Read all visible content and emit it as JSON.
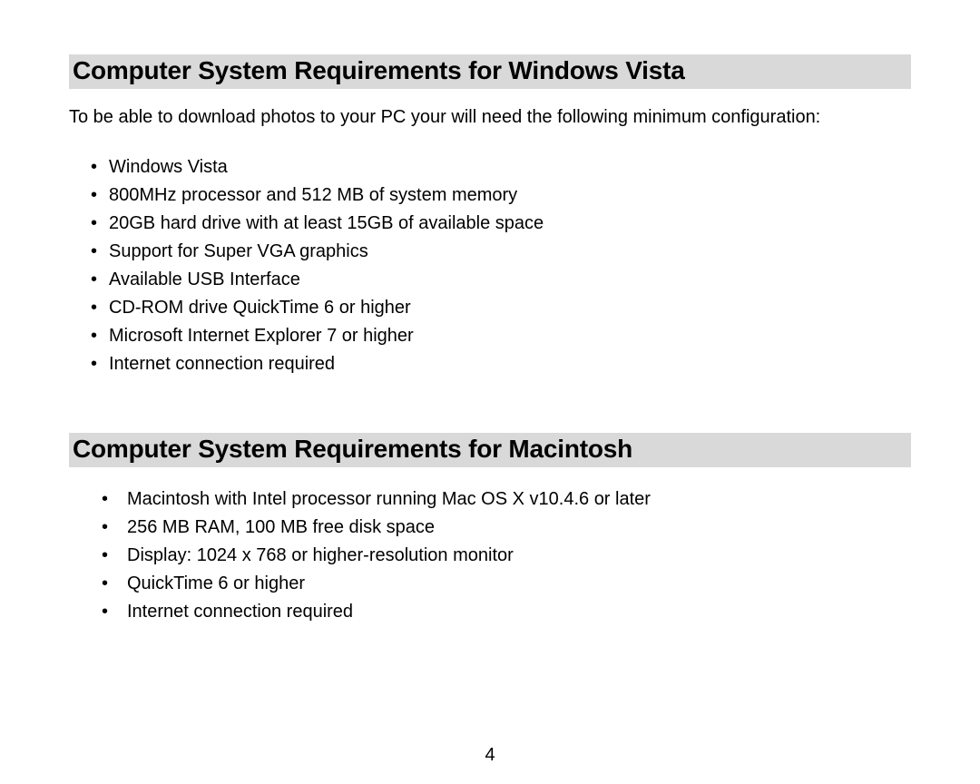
{
  "sections": {
    "windows": {
      "heading": "Computer System Requirements for Windows Vista",
      "intro": "To be able to download photos to your PC your will need the following minimum configuration:",
      "items": [
        "Windows Vista",
        "800MHz processor and 512 MB of system memory",
        "20GB hard drive with at least 15GB of available space",
        "Support for Super VGA graphics",
        "Available USB Interface",
        "CD-ROM drive QuickTime 6 or higher",
        "Microsoft Internet Explorer 7 or higher",
        "Internet connection required"
      ]
    },
    "macintosh": {
      "heading": "Computer System Requirements for Macintosh",
      "items": [
        "Macintosh with Intel processor running Mac OS X v10.4.6 or later",
        "256 MB RAM, 100 MB free disk space",
        "Display: 1024 x 768 or higher-resolution monitor",
        "QuickTime 6 or higher",
        "Internet connection required"
      ]
    }
  },
  "page_number": "4"
}
